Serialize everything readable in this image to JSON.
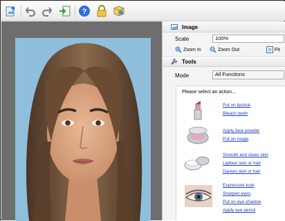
{
  "toolbar": {
    "buttons": [
      "open-image-icon",
      "undo-icon",
      "redo-icon",
      "export-icon",
      "help-icon",
      "lock-icon",
      "package-icon"
    ]
  },
  "image_section": {
    "title": "Image",
    "scale_label": "Scale",
    "scale_value": "100%",
    "zoom_in_label": "Zoom In",
    "zoom_out_label": "Zoom Out",
    "fit_label": "Fit"
  },
  "tools_section": {
    "title": "Tools",
    "mode_label": "Mode",
    "mode_value": "All Functions",
    "prompt": "Please select an action...",
    "groups": [
      {
        "icon": "lipstick-icon",
        "actions": [
          "Put on lipstick",
          "Bleach teeth"
        ]
      },
      {
        "icon": "compact-powder-icon",
        "actions": [
          "Apply face powder",
          "Put on rouge"
        ]
      },
      {
        "icon": "cream-jar-icon",
        "actions": [
          "Smooth and clean skin",
          "Lighten skin or hair",
          "Darken skin or hair"
        ]
      },
      {
        "icon": "eye-makeup-icon",
        "actions": [
          "Expressive look",
          "Sharpen eyes",
          "Put on eye shadow",
          "Apply eye pencil"
        ]
      }
    ]
  },
  "colors": {
    "link": "#1f3fb8",
    "canvas_bg": "#6e6e6e",
    "photo_sky": "#89b9d9"
  }
}
